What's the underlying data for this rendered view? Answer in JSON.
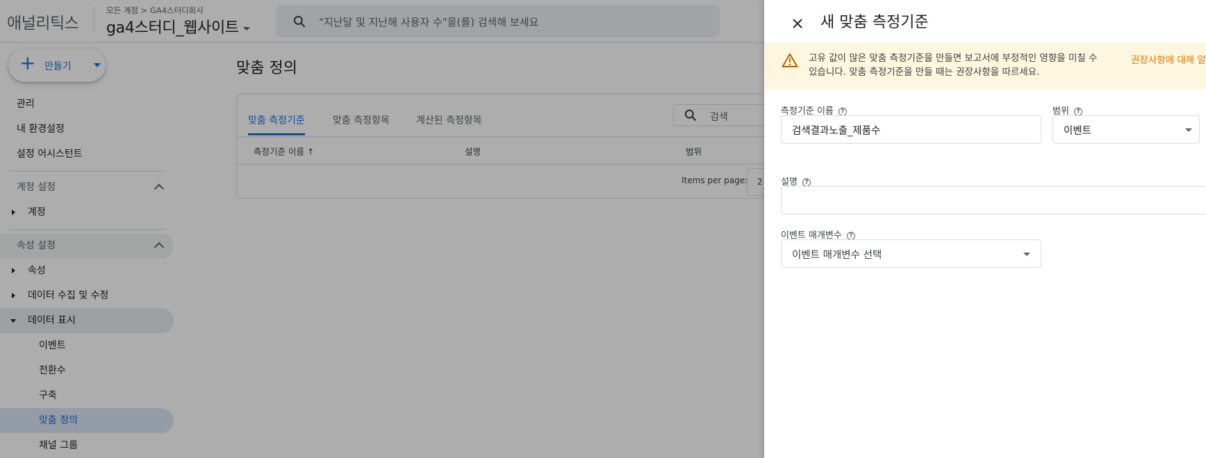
{
  "header": {
    "app_title": "애널리틱스",
    "breadcrumb": "모든 계정 > GA4스터디회사",
    "property": "ga4스터디_웹사이트",
    "search_placeholder": "\"지난달 및 지난해 사용자 수\"을(를) 검색해 보세요"
  },
  "sidebar": {
    "create_label": "만들기",
    "items": [
      {
        "label": "관리"
      },
      {
        "label": "내 환경설정"
      },
      {
        "label": "설정 어시스턴트"
      },
      {
        "label": "계정 설정"
      },
      {
        "label": "계정"
      },
      {
        "label": "속성 설정"
      },
      {
        "label": "속성"
      },
      {
        "label": "데이터 수집 및 수정"
      },
      {
        "label": "데이터 표시"
      },
      {
        "label": "이벤트"
      },
      {
        "label": "전환수"
      },
      {
        "label": "구축"
      },
      {
        "label": "맞춤 정의"
      },
      {
        "label": "채널 그룹"
      }
    ]
  },
  "main": {
    "title": "맞춤 정의",
    "tabs": [
      "맞춤 측정기준",
      "맞춤 측정항목",
      "계산된 측정항목"
    ],
    "search_placeholder": "검색",
    "columns": [
      "측정기준 이름 ↑",
      "설명",
      "범위"
    ],
    "items_per_page_label": "Items per page:",
    "items_per_page_value": "2"
  },
  "drawer": {
    "title": "새 맞춤 측정기준",
    "warning_text": "고유 값이 많은 맞춤 측정기준을 만들면 보고서에 부정적인 영향을 미칠 수 있습니다. 맞춤 측정기준을 만들 때는 권장사항을 따르세요.",
    "warning_link": "권장사항에 대해 알",
    "name_label": "측정기준 이름",
    "name_value": "검색결과노출_제품수",
    "scope_label": "범위",
    "scope_value": "이벤트",
    "description_label": "설명",
    "description_value": "",
    "param_label": "이벤트 매개변수",
    "param_value": "이벤트 매개변수 선택",
    "help_glyph": "?"
  }
}
